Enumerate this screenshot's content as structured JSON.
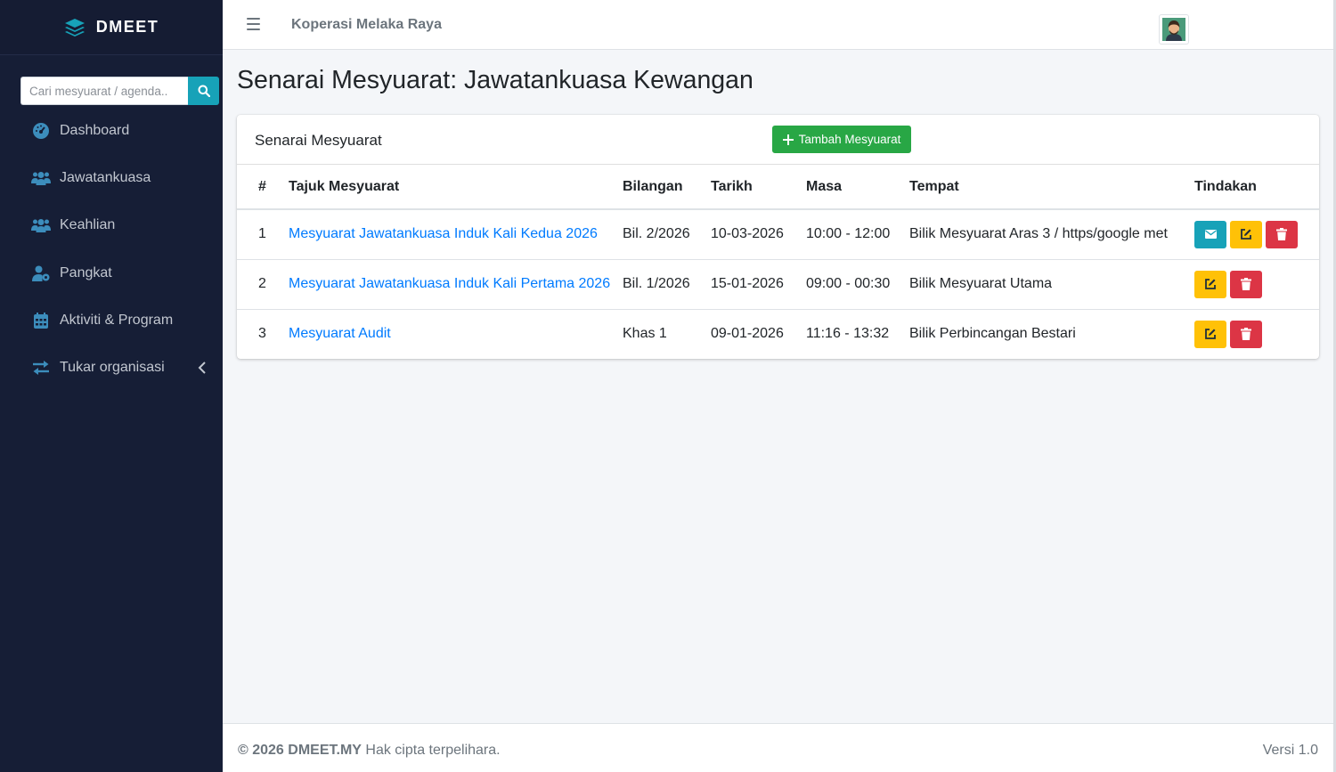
{
  "sidebar": {
    "brand": "DMEET",
    "search_placeholder": "Cari mesyuarat / agenda..",
    "items": [
      {
        "label": "Dashboard",
        "icon": "tachometer-icon"
      },
      {
        "label": "Jawatankuasa",
        "icon": "users-icon"
      },
      {
        "label": "Keahlian",
        "icon": "users-icon"
      },
      {
        "label": "Pangkat",
        "icon": "user-cog-icon"
      },
      {
        "label": "Aktiviti & Program",
        "icon": "calendar-icon"
      },
      {
        "label": "Tukar organisasi",
        "icon": "exchange-icon"
      }
    ]
  },
  "topbar": {
    "org_name": "Koperasi Melaka Raya"
  },
  "main": {
    "page_title": "Senarai Mesyuarat: Jawatankuasa Kewangan",
    "card_title": "Senarai Mesyuarat",
    "add_button": "Tambah Mesyuarat",
    "columns": [
      "#",
      "Tajuk Mesyuarat",
      "Bilangan",
      "Tarikh",
      "Masa",
      "Tempat",
      "Tindakan"
    ],
    "rows": [
      {
        "num": "1",
        "title": "Mesyuarat Jawatankuasa Induk Kali Kedua 2026",
        "bilangan": "Bil. 2/2026",
        "tarikh": "10-03-2026",
        "masa": "10:00 - 12:00",
        "tempat": "Bilik Mesyuarat Aras 3 / https/google met"
      },
      {
        "num": "2",
        "title": "Mesyuarat Jawatankuasa Induk Kali Pertama 2026",
        "bilangan": "Bil. 1/2026",
        "tarikh": "15-01-2026",
        "masa": "09:00 - 00:30",
        "tempat": "Bilik Mesyuarat Utama"
      },
      {
        "num": "3",
        "title": "Mesyuarat Audit",
        "bilangan": "Khas 1",
        "tarikh": "09-01-2026",
        "masa": "11:16 - 13:32",
        "tempat": "Bilik Perbincangan Bestari"
      }
    ]
  },
  "footer": {
    "copyright": "© 2026 DMEET.MY",
    "rights": "Hak cipta terpelihara.",
    "version": "Versi 1.0"
  },
  "colors": {
    "sidebar_bg": "#161e36",
    "icon_blue": "#3c8dbc",
    "success": "#28a745",
    "info": "#17a2b8",
    "warning": "#ffc107",
    "danger": "#dc3545",
    "link": "#007bff"
  }
}
